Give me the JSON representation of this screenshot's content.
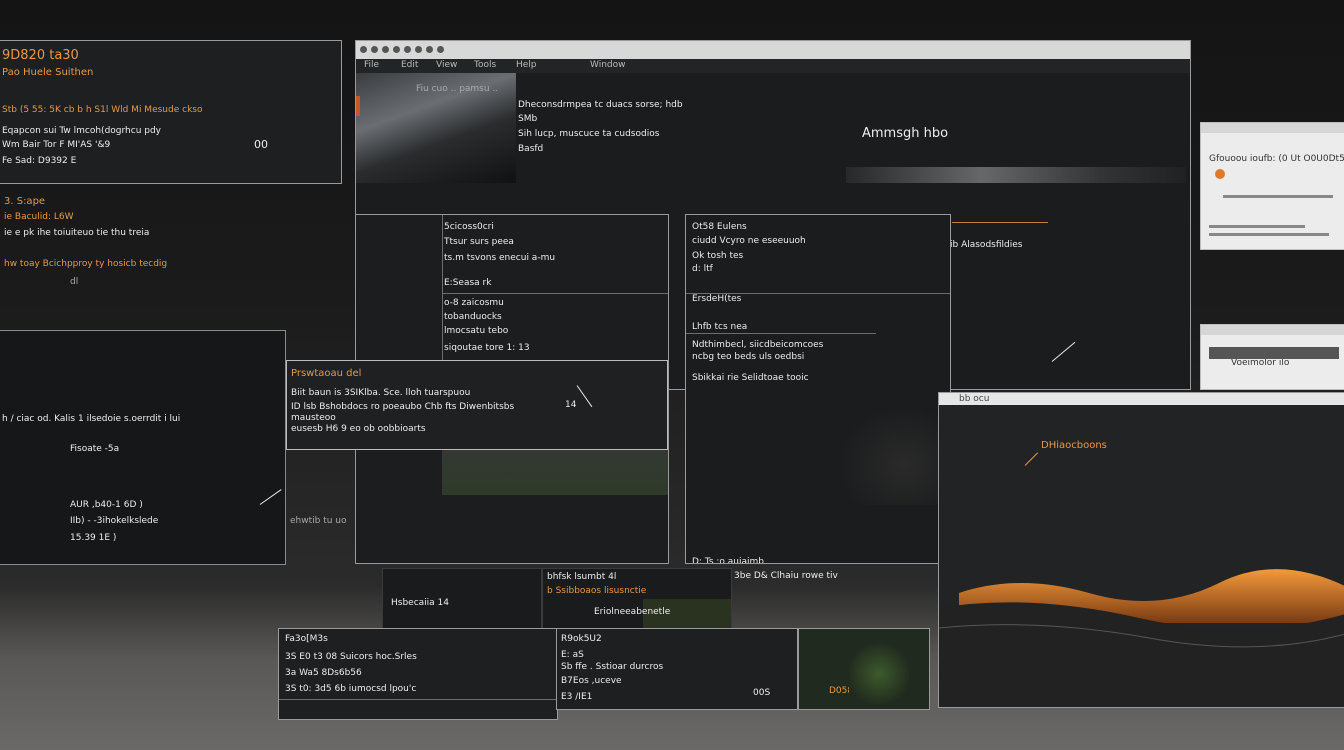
{
  "left_panel": {
    "title": "9D820 ta30",
    "subtitle": "Pao Huele Suithen",
    "lines": [
      "Stb (5 55: 5K cb b h S1l Wld Mi Mesude ckso",
      "Eqapcon sui Tw lmcoh(dogrhcu pdy",
      "Wm Bair Tor F MI'AS '&9",
      "Fe Sad: D9392 E"
    ],
    "badge": "00"
  },
  "left_mid": {
    "heading": "3. S:ape",
    "subheading": "ie Baculid: L6W",
    "line1": "ie e pk ihe toiuiteuo tie thu treia",
    "line2": "hw toay Bcichpproy ty hosicb tecdig",
    "line3": "dl"
  },
  "left_lower": {
    "line1": "h / ciac od. Kalis 1 ilsedoie s.oerrdit i lui",
    "line2": "Fisoate -5a",
    "line3": "AUR ,b40-1 6D )",
    "line4": "IIb) - -3ihokelkslede",
    "line5": "15.39 1E )"
  },
  "main_window": {
    "toolbar_items": [
      "File",
      "Edit",
      "View",
      "Tools",
      "Help",
      "Window"
    ],
    "path_label": "Fiu cuo .. pamsu ..",
    "hero_lines": [
      "Dheconsdrmpea tc duacs sorse; hdb",
      "SMb",
      "Sih lucp, muscuce ta cudsodios",
      "Basfd"
    ],
    "hero_title": "Ammsgh hbo",
    "right_label": "ib Alasodsfildies"
  },
  "inner_a": {
    "title": "5cicoss0cri",
    "lines": [
      "Ttsur surs peea",
      "ts.m tsvons enecui a-mu",
      "E:Seasa rk",
      "o-8 zaicosmu",
      "tobanduocks",
      "lmocsatu tebo",
      "siqoutae tore 1: 13"
    ]
  },
  "inner_b": {
    "title": "Ot58 Eulens",
    "lines": [
      "ciudd Vcyro ne eseeuuoh",
      "Ok tosh tes",
      "d: ltf",
      "ErsdeH(tes",
      "Lhfb tcs nea",
      "Ndthimbecl, siicdbeicomcoes",
      "ncbg teo beds uls oedbsi",
      "Sbikkai rie Selidtoae tooic"
    ]
  },
  "inner_b_lower": {
    "line1": "D: Ts :o auiaimb",
    "line2": "tbd be ts 3be D& Clhaiu rowe tiv"
  },
  "popup": {
    "title": "Prswtaoau del",
    "lines": [
      "Biit baun is 3SIKlba. Sce. lloh tuarspuou",
      "ID lsb Bshobdocs ro poeaubo Chb fts Diwenbitsbs",
      "mausteoo",
      "eusesb H6 9 eo ob oobbioarts"
    ],
    "note": "14"
  },
  "popup_lower": {
    "line1": "ehwtib tu uo"
  },
  "right_window": {
    "orange_label": "DHiaocboons",
    "toolbar_label": "bb ocu"
  },
  "right_cards": {
    "card1_label": "Gfouoou ioufb: (0 Ut O0U0Dt5",
    "card2_label": "Voeimolor ilo"
  },
  "bottom_mid": {
    "line1": "Hsbecaiia 14",
    "line2": "bhfsk lsumbt 4l",
    "line3": "b Ssibboaos lisusnctie",
    "line4": "Eriolneeabenetle"
  },
  "bottom_left": {
    "title": "Fa3o[M3s",
    "lines": [
      "3S E0 t3 08 Suicors hoc.Srles",
      "3a Wa5 8Ds6b56",
      "3S t0: 3d5 6b iumocsd lpou'c"
    ]
  },
  "bottom_right": {
    "title": "R9ok5U2",
    "lines": [
      "E: aS",
      "Sb ffe . Sstioar durcros",
      "B7Eos ,uceve",
      "E3 /IE1"
    ],
    "badge1": "00S",
    "badge2": "D058"
  },
  "colors": {
    "accent": "#e59a4a",
    "panel_bg": "#1e1f20",
    "border": "#9a9a9a",
    "titlebar": "#d8d8d8"
  }
}
